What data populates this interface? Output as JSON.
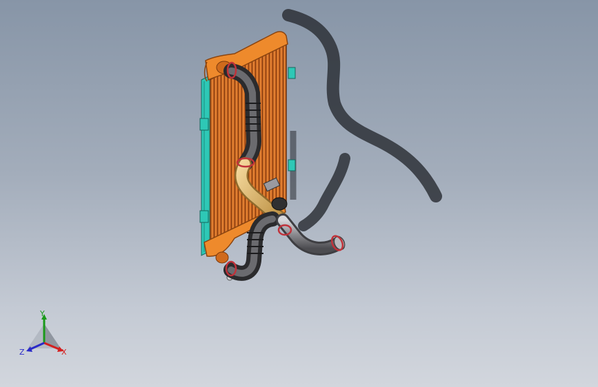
{
  "viewport": {
    "background_top": "#8795a7",
    "background_bottom": "#d2d6dd"
  },
  "model": {
    "parts": [
      "radiator-core",
      "radiator-top-tank",
      "radiator-bottom-tank",
      "side-brackets",
      "upper-hose",
      "lower-hose",
      "tan-pipe",
      "outlet-pipe",
      "hose-clamps"
    ],
    "colors": {
      "core": "#e07a2a",
      "tank": "#ee8a2c",
      "bracket": "#2ec8b6",
      "hose": "#4a4a4a",
      "pipe_tan": "#d9b26a",
      "pipe_metal": "#8c8c90",
      "clamp": "#c0323a",
      "shadow": "#2a2d33"
    }
  },
  "triad": {
    "x_label": "X",
    "y_label": "Y",
    "z_label": "Z",
    "x_color": "#d42020",
    "y_color": "#1a9a1a",
    "z_color": "#2a2ac8"
  }
}
